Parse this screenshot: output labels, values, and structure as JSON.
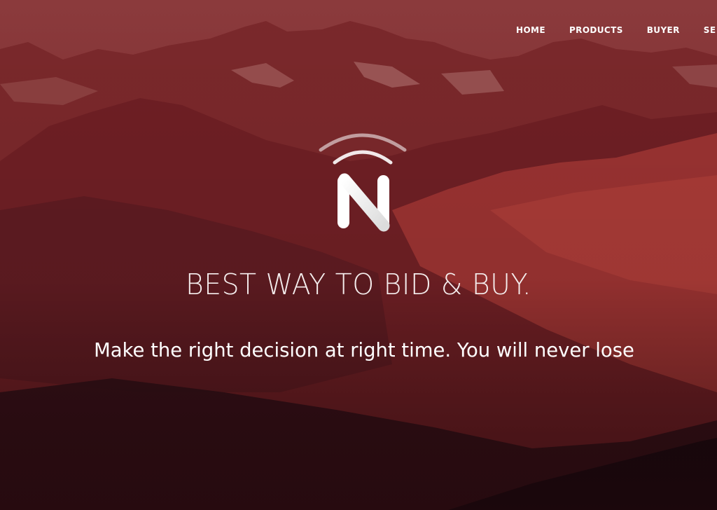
{
  "nav": {
    "items": [
      {
        "label": "HOME"
      },
      {
        "label": "PRODUCTS"
      },
      {
        "label": "BUYER"
      },
      {
        "label": "SE"
      }
    ]
  },
  "logo": {
    "icon": "n-signal-logo-icon",
    "letter": "N"
  },
  "hero": {
    "headline": "BEST WAY TO BID & BUY.",
    "subline": "Make the right decision at right time. You will never lose"
  },
  "colors": {
    "overlay": "#8e2a2c",
    "text": "#ffffff"
  }
}
